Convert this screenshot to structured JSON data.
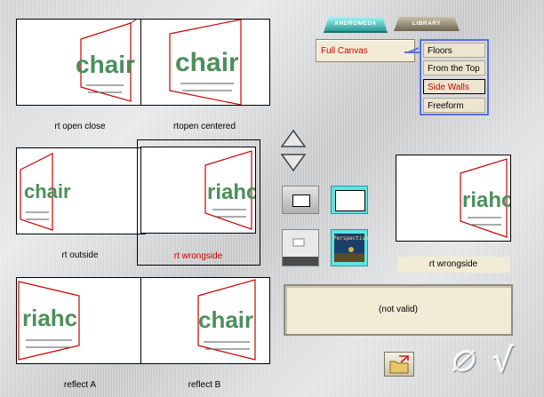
{
  "tabs": [
    {
      "label": "ANDROMEDA",
      "active": true
    },
    {
      "label": "LIBRARY",
      "active": false
    }
  ],
  "canvas": {
    "value": "Full Canvas"
  },
  "menu": {
    "items": [
      "Floors",
      "From the Top",
      "Side Walls",
      "Freeform"
    ],
    "selected": "Side Walls"
  },
  "thumbnails": [
    {
      "label": "rt open close",
      "selected": false
    },
    {
      "label": "rtopen centered",
      "selected": false
    },
    {
      "label": "rt outside",
      "selected": false
    },
    {
      "label": "rt wrongside",
      "selected": true
    },
    {
      "label": "reflect A",
      "selected": false
    },
    {
      "label": "reflect B",
      "selected": false
    }
  ],
  "thumb_text": {
    "forward": "chair",
    "mirrored": "riahc"
  },
  "tool_buttons": {
    "perspective_label": "Perspective"
  },
  "preview": {
    "label": "rt wrongside"
  },
  "status": {
    "text": "(not valid)"
  },
  "actions": {
    "cancel_glyph": "∅",
    "ok_glyph": "√"
  },
  "colors": {
    "accent_red": "#cc0000",
    "highlight_cyan": "#5fe4e0",
    "menu_border": "#5a6fe0",
    "panel_cream": "#f2ecd6"
  }
}
